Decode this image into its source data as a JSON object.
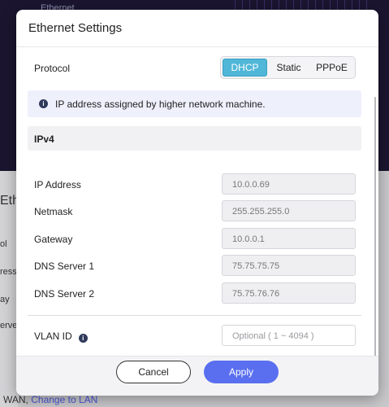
{
  "background": {
    "top_label": "Ethernet",
    "panel_title": "Etherne",
    "labels": [
      "ol",
      "ress",
      "ay",
      "erver"
    ],
    "footer_prefix": "WAN,",
    "footer_link": "Change to LAN"
  },
  "modal": {
    "title": "Ethernet Settings",
    "protocol": {
      "label": "Protocol",
      "options": [
        "DHCP",
        "Static",
        "PPPoE"
      ],
      "selected": "DHCP"
    },
    "info_text": "IP address assigned by higher network machine.",
    "section_title": "IPv4",
    "fields": [
      {
        "label": "IP Address",
        "value": "10.0.0.69"
      },
      {
        "label": "Netmask",
        "value": "255.255.255.0"
      },
      {
        "label": "Gateway",
        "value": "10.0.0.1"
      },
      {
        "label": "DNS Server 1",
        "value": "75.75.75.75"
      },
      {
        "label": "DNS Server 2",
        "value": "75.75.76.76"
      }
    ],
    "vlan": {
      "label": "VLAN ID",
      "value": "",
      "placeholder": "Optional ( 1 ~ 4094 )"
    },
    "footer": {
      "cancel_label": "Cancel",
      "apply_label": "Apply"
    }
  },
  "colors": {
    "accent_selected": "#50b7d8",
    "apply_button": "#5a6ff0",
    "info_background": "#eef0fc"
  },
  "icons": [
    "info-icon",
    "help-icon"
  ]
}
